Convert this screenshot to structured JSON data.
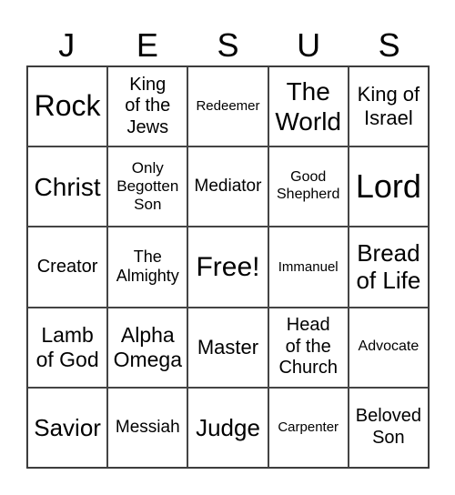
{
  "header": [
    "J",
    "E",
    "S",
    "U",
    "S"
  ],
  "cells": [
    "Rock",
    "King of the Jews",
    "Redeemer",
    "The World",
    "King of Israel",
    "Christ",
    "Only Begotten Son",
    "Mediator",
    "Good Shepherd",
    "Lord",
    "Creator",
    "The Almighty",
    "Free!",
    "Immanuel",
    "Bread of Life",
    "Lamb of God",
    "Alpha Omega",
    "Master",
    "Head of the Church",
    "Advocate",
    "Savior",
    "Messiah",
    "Judge",
    "Carpenter",
    "Beloved Son"
  ]
}
